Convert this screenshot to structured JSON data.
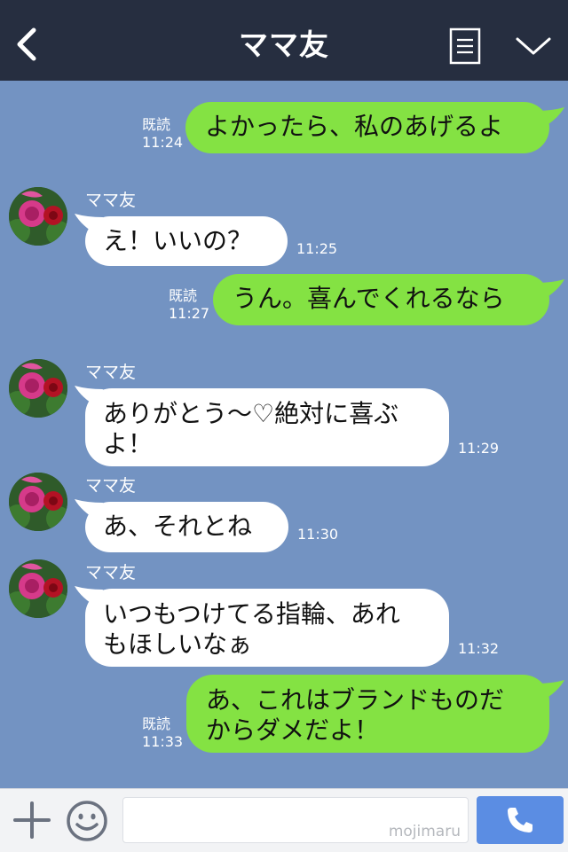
{
  "header": {
    "title": "ママ友"
  },
  "contact_name": "ママ友",
  "messages": [
    {
      "side": "out",
      "text": "よかったら、私のあげるよ",
      "read": "既読",
      "time": "11:24"
    },
    {
      "side": "in",
      "sender": "ママ友",
      "text": "え！いいの？",
      "time": "11:25"
    },
    {
      "side": "out",
      "text": "うん。喜んでくれるなら",
      "read": "既読",
      "time": "11:27"
    },
    {
      "side": "in",
      "sender": "ママ友",
      "lines": [
        "ありがとう〜♡絶対に喜ぶ",
        "よ！"
      ],
      "time": "11:29"
    },
    {
      "side": "in",
      "sender": "ママ友",
      "text": "あ、それとね",
      "time": "11:30"
    },
    {
      "side": "in",
      "sender": "ママ友",
      "lines": [
        "いつもつけてる指輪、あれ",
        "もほしいなぁ"
      ],
      "time": "11:32"
    },
    {
      "side": "out",
      "lines": [
        "あ、これはブランドものだ",
        "からダメだよ！"
      ],
      "read": "既読",
      "time": "11:33"
    }
  ],
  "input": {
    "watermark": "mojimaru"
  },
  "icons": {
    "back": "chevron-left-icon",
    "menu": "menu-list-icon",
    "collapse": "chevron-down-icon",
    "add": "plus-icon",
    "emoji": "smiley-icon",
    "call": "phone-icon"
  }
}
